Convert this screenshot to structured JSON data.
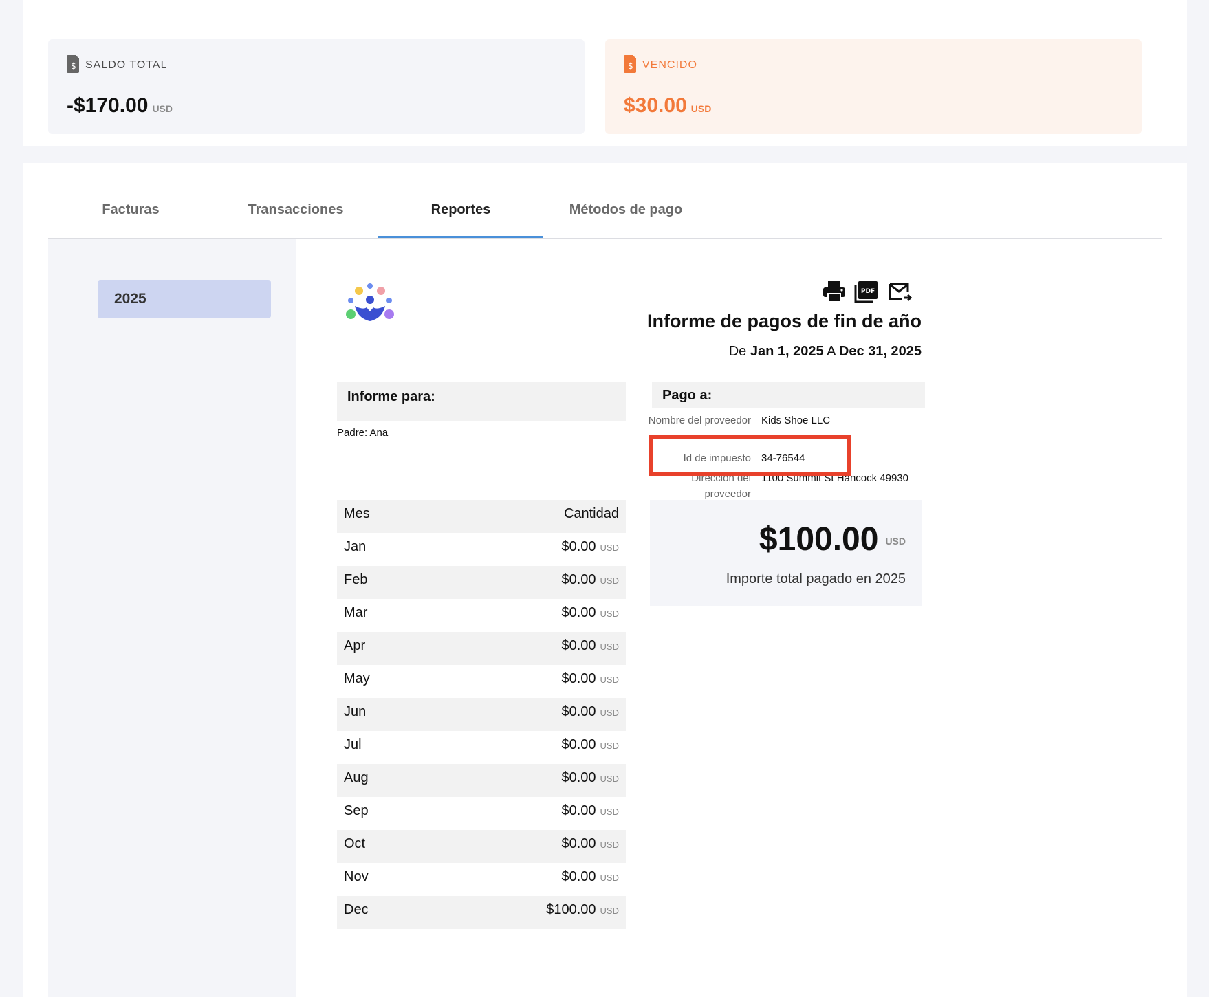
{
  "summary": {
    "balance": {
      "label": "SALDO TOTAL",
      "amount": "-$170.00",
      "currency": "USD"
    },
    "overdue": {
      "label": "VENCIDO",
      "amount": "$30.00",
      "currency": "USD",
      "color": "#f2793a"
    }
  },
  "tabs": [
    "Facturas",
    "Transacciones",
    "Reportes",
    "Métodos de pago"
  ],
  "active_tab": "Reportes",
  "sidebar": {
    "year": "2025"
  },
  "report": {
    "title": "Informe de pagos de fin de año",
    "range_prefix": "De",
    "range_start": "Jan 1, 2025",
    "range_mid": "A",
    "range_end": "Dec 31, 2025",
    "action_icons": [
      "print-icon",
      "pdf-icon",
      "email-icon"
    ],
    "informe_para": {
      "heading": "Informe para:",
      "parent": "Padre: Ana"
    },
    "pago_a": {
      "heading": "Pago a:",
      "provider_name_label": "Nombre del proveedor",
      "provider_name": "Kids Shoe LLC",
      "tax_id_label": "Id de impuesto",
      "tax_id": "34-76544",
      "address_label": "Dirección del proveedor",
      "address": "1100 Summit St Hancock 49930"
    },
    "total": {
      "amount": "$100.00",
      "currency": "USD",
      "caption": "Importe total pagado en 2025"
    },
    "table": {
      "header_month": "Mes",
      "header_amount": "Cantidad",
      "currency": "USD",
      "rows": [
        {
          "month": "Jan",
          "amount": "$0.00"
        },
        {
          "month": "Feb",
          "amount": "$0.00"
        },
        {
          "month": "Mar",
          "amount": "$0.00"
        },
        {
          "month": "Apr",
          "amount": "$0.00"
        },
        {
          "month": "May",
          "amount": "$0.00"
        },
        {
          "month": "Jun",
          "amount": "$0.00"
        },
        {
          "month": "Jul",
          "amount": "$0.00"
        },
        {
          "month": "Aug",
          "amount": "$0.00"
        },
        {
          "month": "Sep",
          "amount": "$0.00"
        },
        {
          "month": "Oct",
          "amount": "$0.00"
        },
        {
          "month": "Nov",
          "amount": "$0.00"
        },
        {
          "month": "Dec",
          "amount": "$100.00"
        }
      ]
    }
  },
  "highlight_color": "#e8412b"
}
